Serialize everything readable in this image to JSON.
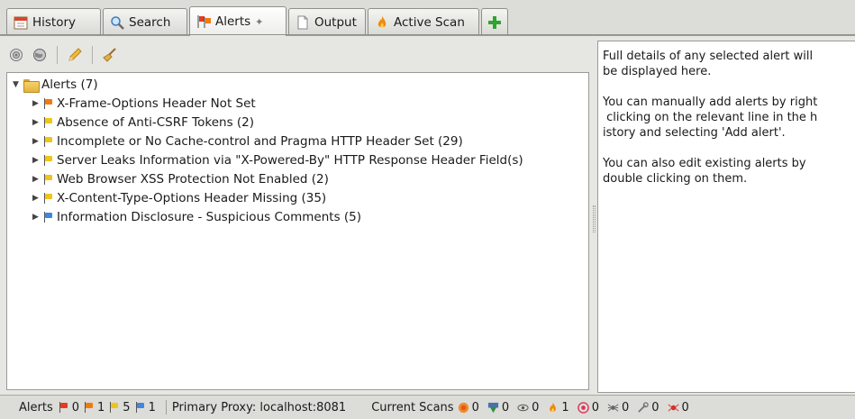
{
  "tabs": [
    {
      "label": "History",
      "icon": "calendar-icon",
      "active": false
    },
    {
      "label": "Search",
      "icon": "magnifier-icon",
      "active": false
    },
    {
      "label": "Alerts",
      "icon": "flags-icon",
      "active": true
    },
    {
      "label": "Output",
      "icon": "document-icon",
      "active": false
    },
    {
      "label": "Active Scan",
      "icon": "flame-icon",
      "active": false
    }
  ],
  "add_tab_icon": "plus-icon",
  "toolbar": {
    "buttons": [
      "target-icon",
      "globe-icon",
      "pencil-icon",
      "broom-icon"
    ]
  },
  "tree": {
    "root": {
      "label": "Alerts (7)"
    },
    "items": [
      {
        "label": "X-Frame-Options Header Not Set",
        "risk": "medium",
        "color": "#f07a10"
      },
      {
        "label": "Absence of Anti-CSRF Tokens (2)",
        "risk": "low",
        "color": "#f0c419"
      },
      {
        "label": "Incomplete or No Cache-control and Pragma HTTP Header Set (29)",
        "risk": "low",
        "color": "#f0c419"
      },
      {
        "label": "Server Leaks Information via \"X-Powered-By\" HTTP Response Header Field(s)",
        "risk": "low",
        "color": "#f0c419"
      },
      {
        "label": "Web Browser XSS Protection Not Enabled (2)",
        "risk": "low",
        "color": "#f0c419"
      },
      {
        "label": "X-Content-Type-Options Header Missing (35)",
        "risk": "low",
        "color": "#f0c419"
      },
      {
        "label": "Information Disclosure - Suspicious Comments (5)",
        "risk": "info",
        "color": "#3f86e0"
      }
    ]
  },
  "detail": {
    "para1": "Full details of any selected alert will\nbe displayed here.",
    "para2": "You can manually add alerts by right\n clicking on the relevant line in the h\nistory and selecting 'Add alert'.",
    "para3": "You can also edit existing alerts by\ndouble clicking on them."
  },
  "status": {
    "alerts_label": "Alerts",
    "alert_counts": [
      {
        "value": "0",
        "color": "#e53b1e"
      },
      {
        "value": "1",
        "color": "#f07a10"
      },
      {
        "value": "5",
        "color": "#f0c419"
      },
      {
        "value": "1",
        "color": "#3f86e0"
      }
    ],
    "proxy": "Primary Proxy: localhost:8081",
    "scans_label": "Current Scans",
    "scan_counts": [
      {
        "icon": "spider-ajax-icon",
        "value": "0"
      },
      {
        "icon": "download-icon",
        "value": "0"
      },
      {
        "icon": "eye-icon",
        "value": "0"
      },
      {
        "icon": "flame-icon",
        "value": "1"
      },
      {
        "icon": "target-icon",
        "value": "0"
      },
      {
        "icon": "spider-icon",
        "value": "0"
      },
      {
        "icon": "wrench-icon",
        "value": "0"
      },
      {
        "icon": "bug-icon",
        "value": "0"
      }
    ]
  }
}
